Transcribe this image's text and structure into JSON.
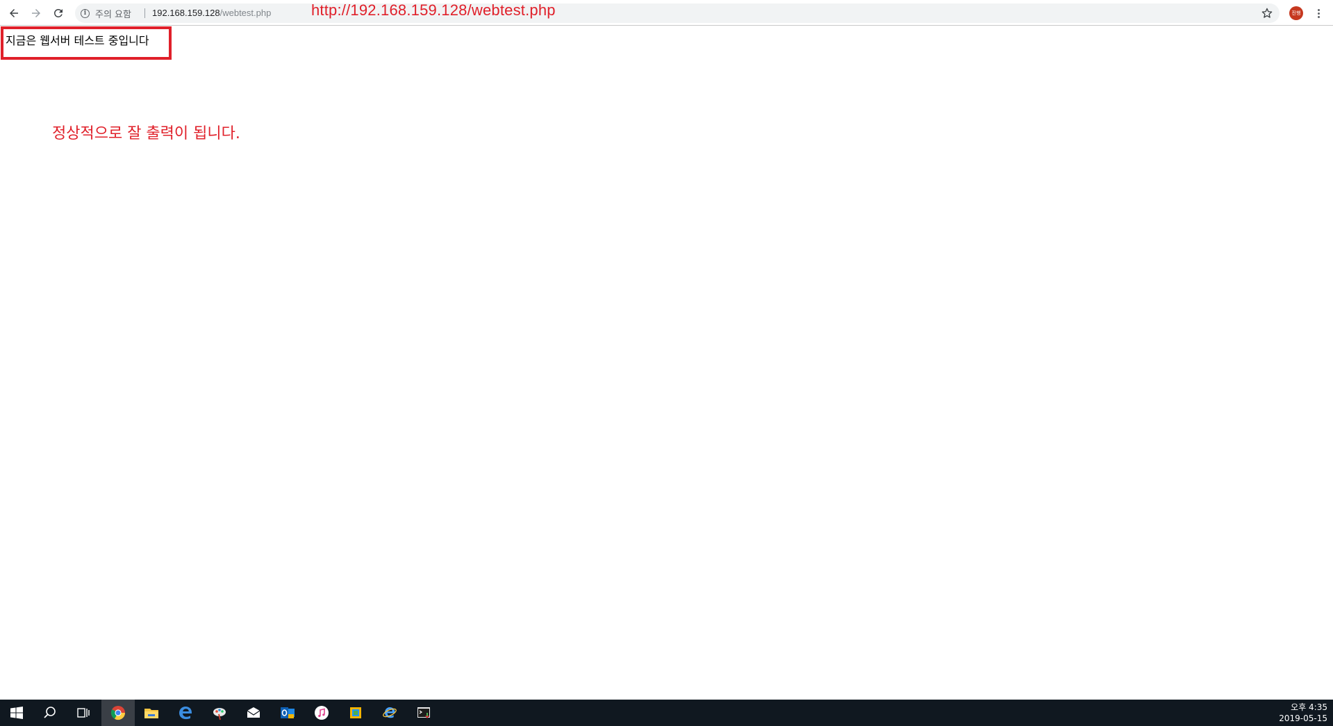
{
  "browser": {
    "security_label": "주의 요함",
    "url_host": "192.168.159.128",
    "url_path": "/webtest.php",
    "profile_initials": "진행"
  },
  "page": {
    "body_text": "지금은 웹서버 테스트 중입니다"
  },
  "annotations": {
    "url_callout": "http://192.168.159.128/webtest.php",
    "result_note": "정상적으로 잘 출력이 됩니다.",
    "color": "#e0202a"
  },
  "taskbar": {
    "apps": [
      "start-icon",
      "search-icon",
      "task-view-icon",
      "chrome-icon",
      "file-explorer-icon",
      "edge-icon",
      "paint-icon",
      "mail-icon",
      "outlook-icon",
      "itunes-icon",
      "store-icon",
      "ie-icon",
      "terminal-icon"
    ],
    "time": "오후 4:35",
    "date": "2019-05-15"
  }
}
